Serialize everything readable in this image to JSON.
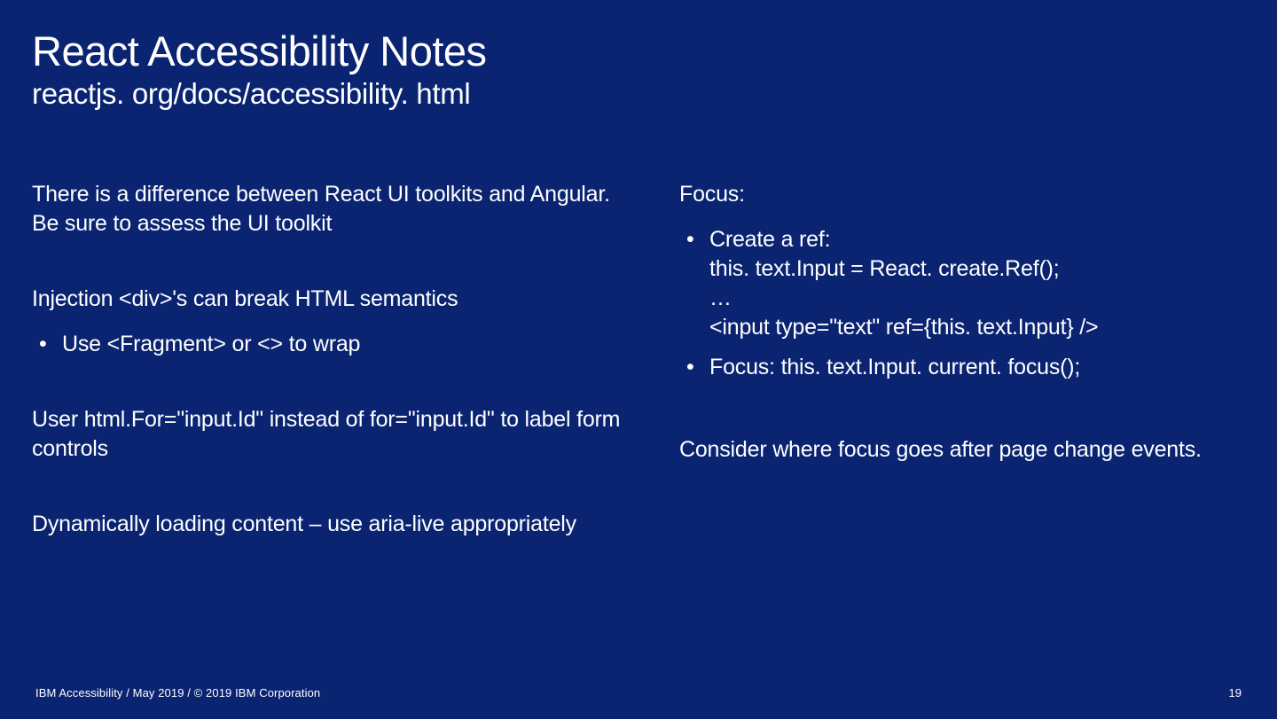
{
  "title": "React Accessibility Notes",
  "subtitle": "reactjs. org/docs/accessibility. html",
  "left": {
    "p1": "There is a difference between React UI toolkits and Angular. Be sure to assess the UI toolkit",
    "p2": "Injection <div>'s can break HTML semantics",
    "b1": "Use <Fragment> or <> to wrap",
    "p3": "User html.For=\"input.Id\" instead of for=\"input.Id\" to label form controls",
    "p4": "Dynamically loading content – use aria-live appropriately"
  },
  "right": {
    "focusLabel": "Focus:",
    "b1": "Create a ref:\nthis. text.Input = React. create.Ref();\n…\n<input type=\"text\" ref={this. text.Input} />",
    "b2": "Focus: this. text.Input. current. focus();",
    "p1": "Consider where focus goes after page change events."
  },
  "footer": {
    "left": "IBM Accessibility / May 2019 / © 2019 IBM Corporation",
    "page": "19"
  }
}
